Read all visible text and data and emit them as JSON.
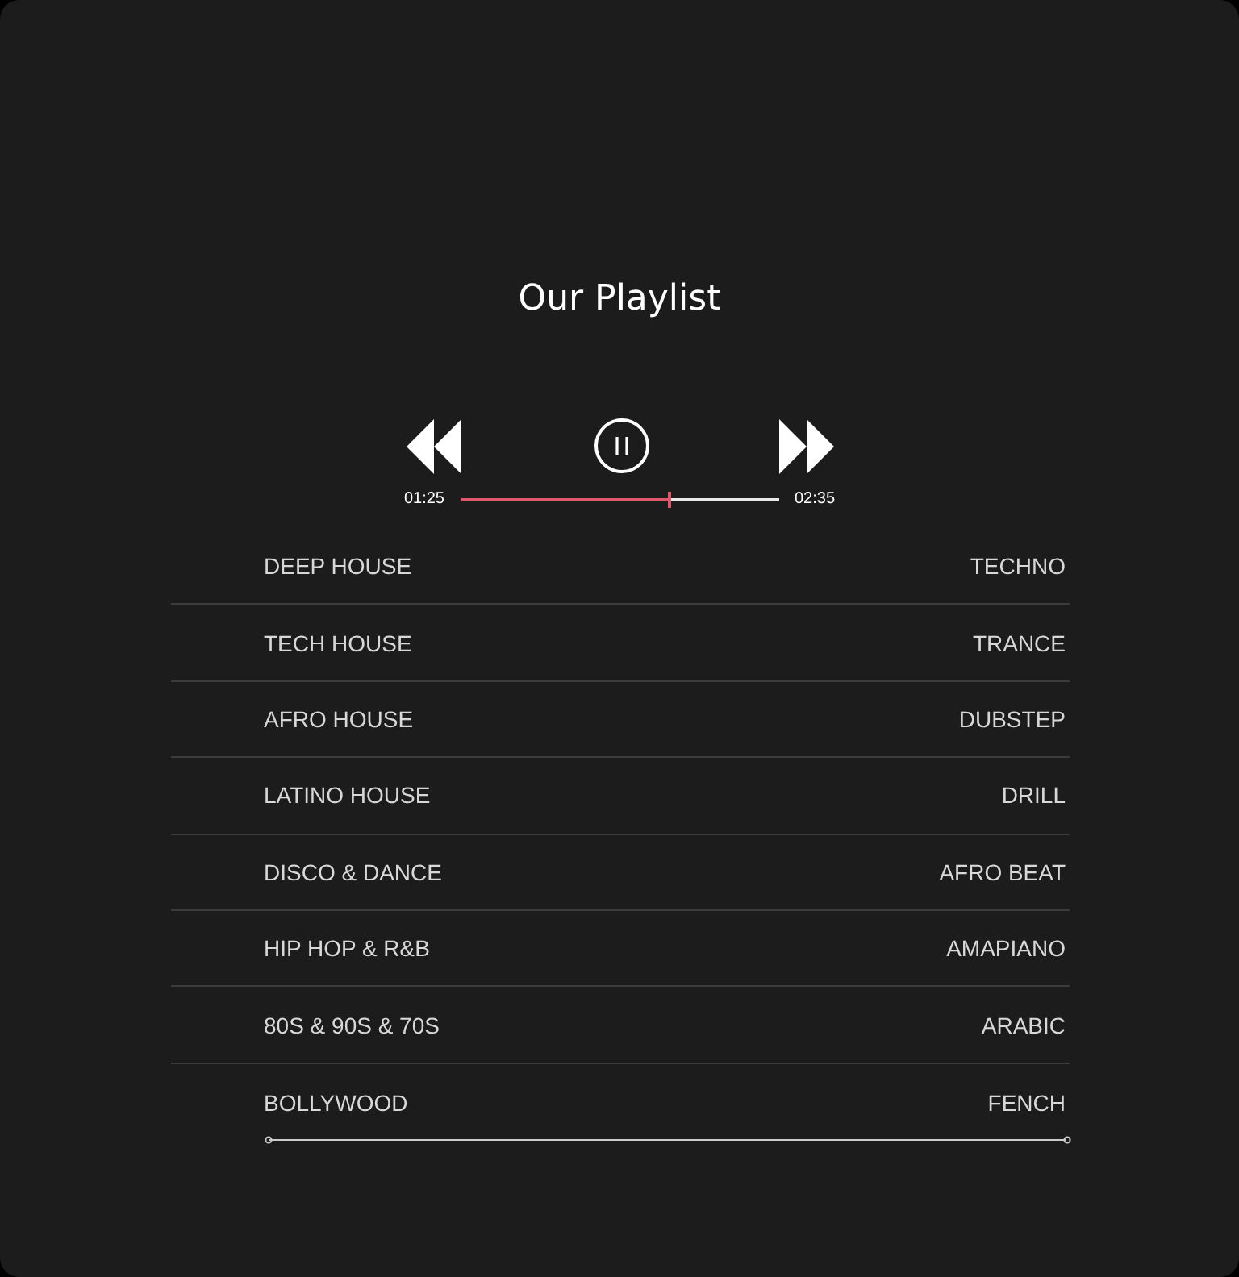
{
  "title": "Our Playlist",
  "player": {
    "playing": true,
    "elapsed": "01:25",
    "duration": "02:35",
    "level": 0.655
  },
  "genres": [
    {
      "left": "DEEP HOUSE",
      "right": "TECHNO"
    },
    {
      "left": "TECH HOUSE",
      "right": "TRANCE"
    },
    {
      "left": "AFRO HOUSE",
      "right": "DUBSTEP"
    },
    {
      "left": "LATINO HOUSE",
      "right": "DRILL"
    },
    {
      "left": "DISCO & DANCE",
      "right": "AFRO BEAT"
    },
    {
      "left": "HIP HOP & R&B",
      "right": "AMAPIANO"
    },
    {
      "left": "80S & 90S & 70S",
      "right": "ARABIC"
    },
    {
      "left": "BOLLYWOOD",
      "right": "FENCH"
    }
  ]
}
